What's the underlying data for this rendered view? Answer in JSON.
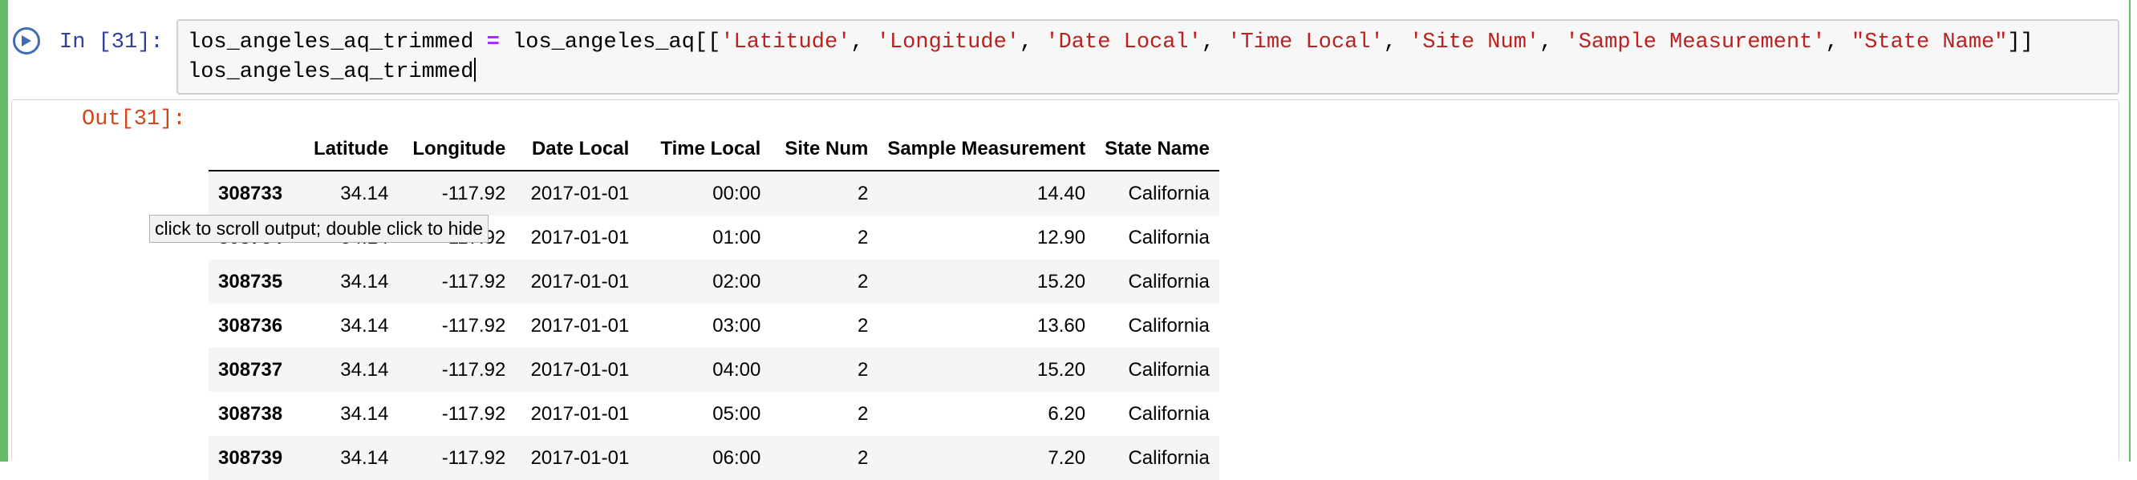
{
  "input": {
    "prompt": "In [31]:",
    "line1": {
      "var": "los_angeles_aq_trimmed ",
      "op": "=",
      "expr_start": " los_angeles_aq[[",
      "cols": [
        "'Latitude'",
        "'Longitude'",
        "'Date Local'",
        "'Time Local'",
        "'Site Num'",
        "'Sample Measurement'",
        "\"State Name\""
      ],
      "sep": ", ",
      "expr_end": "]]"
    },
    "line2": "los_angeles_aq_trimmed"
  },
  "output": {
    "prompt": "Out[31]:",
    "table": {
      "headers": [
        "",
        "Latitude",
        "Longitude",
        "Date Local",
        "Time Local",
        "Site Num",
        "Sample Measurement",
        "State Name"
      ],
      "rows": [
        [
          "308733",
          "34.14",
          "-117.92",
          "2017-01-01",
          "00:00",
          "2",
          "14.40",
          "California"
        ],
        [
          "308734",
          "34.14",
          "-117.92",
          "2017-01-01",
          "01:00",
          "2",
          "12.90",
          "California"
        ],
        [
          "308735",
          "34.14",
          "-117.92",
          "2017-01-01",
          "02:00",
          "2",
          "15.20",
          "California"
        ],
        [
          "308736",
          "34.14",
          "-117.92",
          "2017-01-01",
          "03:00",
          "2",
          "13.60",
          "California"
        ],
        [
          "308737",
          "34.14",
          "-117.92",
          "2017-01-01",
          "04:00",
          "2",
          "15.20",
          "California"
        ],
        [
          "308738",
          "34.14",
          "-117.92",
          "2017-01-01",
          "05:00",
          "2",
          "6.20",
          "California"
        ],
        [
          "308739",
          "34.14",
          "-117.92",
          "2017-01-01",
          "06:00",
          "2",
          "7.20",
          "California"
        ]
      ]
    },
    "tooltip": "click to scroll output; double click to hide"
  },
  "icons": {
    "run": "run-cell-icon"
  },
  "colors": {
    "cell_selected_bar": "#66bb6a",
    "in_prompt": "#303f9f",
    "out_prompt": "#d84315",
    "string": "#ba2121",
    "operator": "#aa22ff"
  }
}
